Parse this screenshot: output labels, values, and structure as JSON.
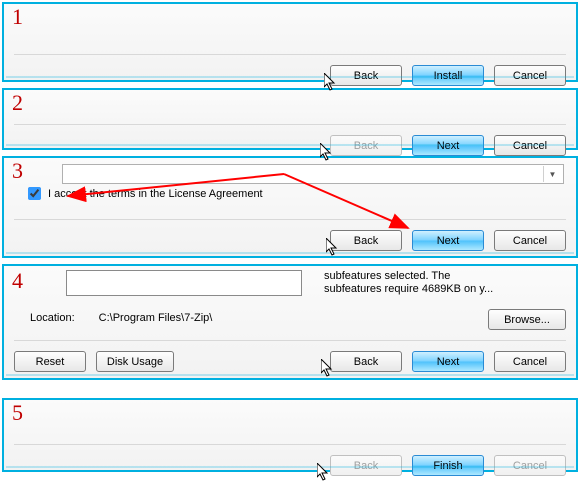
{
  "steps": {
    "s1": {
      "num": "1",
      "back": "Back",
      "primary": "Install",
      "cancel": "Cancel"
    },
    "s2": {
      "num": "2",
      "back": "Back",
      "primary": "Next",
      "cancel": "Cancel"
    },
    "s3": {
      "num": "3",
      "dropdown_value": "",
      "accept_label": "I accept the terms in the License Agreement",
      "back": "Back",
      "primary": "Next",
      "cancel": "Cancel"
    },
    "s4": {
      "num": "4",
      "desc_line1": "subfeatures selected. The",
      "desc_line2": "subfeatures require 4689KB on y...",
      "location_label": "Location:",
      "location_path": "C:\\Program Files\\7-Zip\\",
      "browse": "Browse...",
      "reset": "Reset",
      "disk_usage": "Disk Usage",
      "back": "Back",
      "primary": "Next",
      "cancel": "Cancel"
    },
    "s5": {
      "num": "5",
      "back": "Back",
      "primary": "Finish",
      "cancel": "Cancel"
    }
  }
}
